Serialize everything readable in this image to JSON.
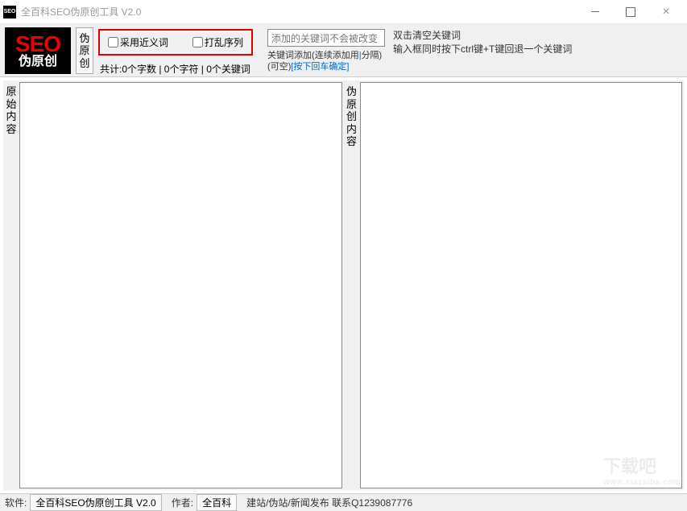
{
  "window": {
    "title": "全百科SEO伪原创工具 V2.0",
    "icon_text": "SEO"
  },
  "logo": {
    "big": "SEO",
    "sub": "伪原创"
  },
  "vtab_label": "伪原创",
  "options": {
    "synonym_label": "采用近义词",
    "shuffle_label": "打乱序列"
  },
  "stats": {
    "text": "共计:0个字数 | 0个字符 | 0个关键词"
  },
  "keyword": {
    "placeholder": "添加的关键词不会被改变",
    "hint_prefix": "关键词添加(连续添加用",
    "hint_sep": "|",
    "hint_mid": "分隔)(可空)",
    "hint_suffix": "[按下回车确定]"
  },
  "right_hint": {
    "line1": "双击清空关键词",
    "line2": "输入框同时按下ctrl键+T键回退一个关键词"
  },
  "panels": {
    "original_label": "原始内容",
    "rewrite_label": "伪原创内容"
  },
  "status": {
    "software_lbl": "软件:",
    "software_val": "全百科SEO伪原创工具 V2.0",
    "author_lbl": "作者:",
    "author_val": "全百科",
    "features": "建站/伪站/新闻发布 联系Q1239087776"
  },
  "watermark": {
    "big": "下载吧",
    "small": "www.xiazaiba.com"
  }
}
